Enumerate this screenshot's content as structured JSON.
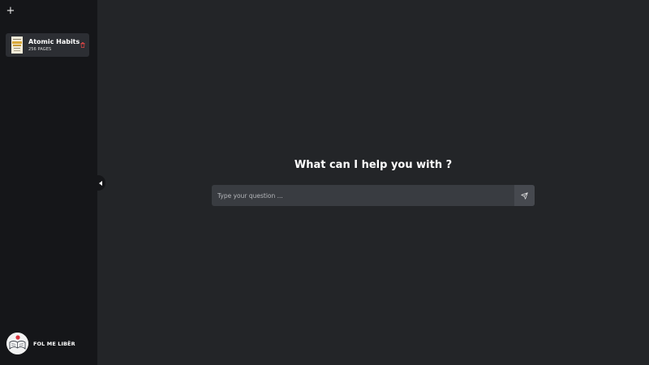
{
  "sidebar": {
    "add_button_icon": "plus-icon",
    "add_button_label": "+",
    "books": [
      {
        "title": "Atomic Habits",
        "pages": "256 PAGES",
        "delete_icon": "trash-icon"
      }
    ],
    "collapse_icon": "chevron-left-icon"
  },
  "profile": {
    "name": "FOL ME LIBËR",
    "avatar_icon": "open-book-logo"
  },
  "main": {
    "heading": "What can I help you with ?",
    "question": {
      "placeholder": "Type your question ...",
      "value": ""
    },
    "send_icon": "paper-plane-icon"
  },
  "colors": {
    "sidebar_bg": "#151619",
    "main_bg": "#232528",
    "card_bg": "#2c2e33",
    "input_bg": "#393c41",
    "send_bg": "#46494f",
    "delete": "#e04646"
  }
}
